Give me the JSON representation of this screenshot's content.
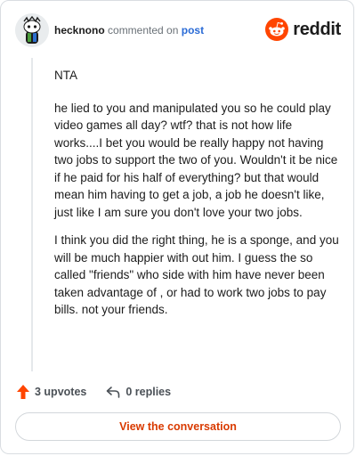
{
  "header": {
    "username": "hecknono",
    "verb": "commented on",
    "post_link": "post",
    "brand": "reddit"
  },
  "comment": {
    "paragraphs": [
      "NTA",
      "he lied to you and manipulated you so he could play video games all day? wtf? that is not how life works....I bet you would be really happy not having two jobs to support the two of you. Wouldn't it be nice if he paid for his half of everything? but that would mean him having to get a job, a job he doesn't like, just like I am sure you don't love your two jobs.",
      "I think you did the right thing, he is a sponge, and you will be much happier with out him. I guess the so called \"friends\" who side with him have never been taken advantage of , or had to work two jobs to pay bills. not your friends."
    ]
  },
  "actions": {
    "upvotes": "3 upvotes",
    "replies": "0 replies"
  },
  "button": {
    "label": "View the conversation"
  },
  "colors": {
    "accent": "#d93a00",
    "link": "#2a6bd6",
    "upvote": "#ff4500"
  },
  "icons": [
    "avatar",
    "reddit-logo-icon",
    "upvote-arrow-icon",
    "reply-icon"
  ]
}
